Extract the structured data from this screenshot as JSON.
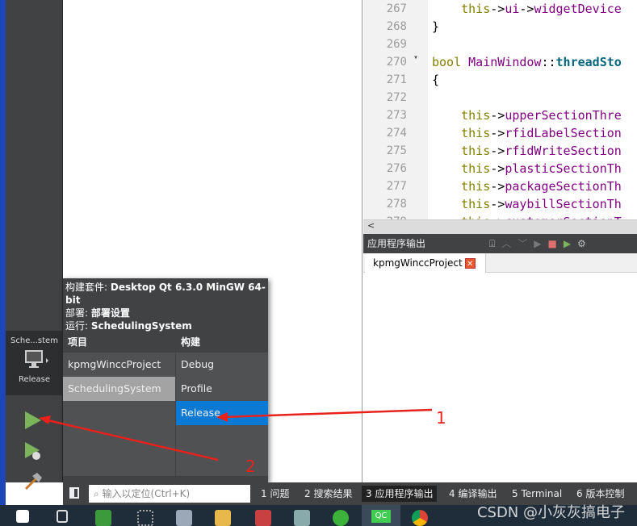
{
  "editor": {
    "lines": [
      {
        "n": "267",
        "code": "    this->ui->widgetDevice"
      },
      {
        "n": "268",
        "code": "}"
      },
      {
        "n": "269",
        "code": ""
      },
      {
        "n": "270",
        "code": "bool MainWindow::threadSto",
        "fold": true
      },
      {
        "n": "271",
        "code": "{"
      },
      {
        "n": "272",
        "code": ""
      },
      {
        "n": "273",
        "code": "    this->upperSectionThre"
      },
      {
        "n": "274",
        "code": "    this->rfidLabelSection"
      },
      {
        "n": "275",
        "code": "    this->rfidWriteSection"
      },
      {
        "n": "276",
        "code": "    this->plasticSectionTh"
      },
      {
        "n": "277",
        "code": "    this->packageSectionTh"
      },
      {
        "n": "278",
        "code": "    this->waybillSectionTh"
      },
      {
        "n": "279",
        "code": "    this->customerSectionT"
      }
    ]
  },
  "output": {
    "title": "应用程序输出",
    "tab": "kpmgWinccProject"
  },
  "kit": {
    "name": "Sche...stem",
    "mode": "Release"
  },
  "popup": {
    "kit_label": "构建套件:",
    "kit_value": "Desktop Qt 6.3.0 MinGW 64-bit",
    "deploy_label": "部署:",
    "deploy_value": "部署设置",
    "run_label": "运行:",
    "run_value": "SchedulingSystem",
    "projects_header": "项目",
    "build_header": "构建",
    "projects": [
      "kpmgWinccProject",
      "SchedulingSystem"
    ],
    "selected_project": "SchedulingSystem",
    "builds": [
      "Debug",
      "Profile",
      "Release"
    ],
    "selected_build": "Release"
  },
  "bottombar": {
    "search_placeholder": "输入以定位(Ctrl+K)",
    "tabs": [
      "1  问题",
      "2  搜索结果",
      "3  应用程序输出",
      "4  编译输出",
      "5  Terminal",
      "6  版本控制"
    ],
    "active_tab": "3  应用程序输出"
  },
  "annotations": [
    "1",
    "2"
  ],
  "watermark": "CSDN @小灰灰搞电子",
  "colors": {
    "selection_blue": "#0a7ad5",
    "run_green": "#7cb45c",
    "annotation_red": "#e8221b"
  }
}
